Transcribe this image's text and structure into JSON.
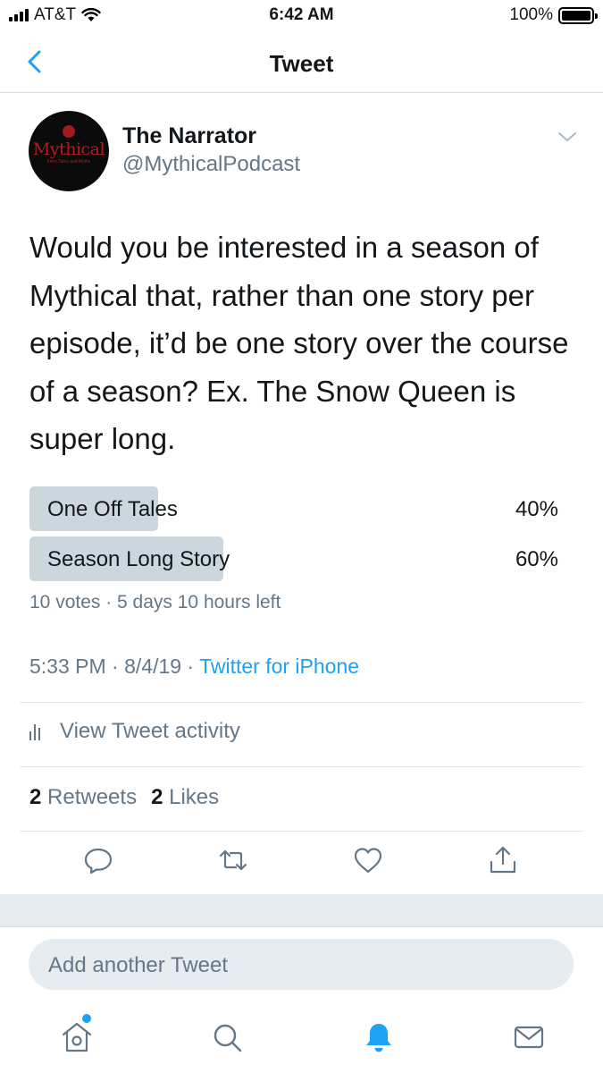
{
  "status_bar": {
    "carrier": "AT&T",
    "time": "6:42 AM",
    "battery": "100%"
  },
  "nav": {
    "title": "Tweet",
    "back_icon": "chevron-left-icon"
  },
  "tweet": {
    "display_name": "The Narrator",
    "handle": "@MythicalPodcast",
    "avatar_text": "Mythical",
    "avatar_subtext": "Fairy Tales and Myths",
    "text": "Would you be interested in a season of Mythical that, rather than one story per episode, it’d be one story over the course of a season? Ex. The Snow Queen is super long.",
    "poll": {
      "options": [
        {
          "label": "One Off Tales",
          "percent_text": "40%",
          "share": 0.4
        },
        {
          "label": "Season Long Story",
          "percent_text": "60%",
          "share": 0.6
        }
      ],
      "meta": "10 votes · 5 days 10 hours left"
    },
    "timestamp": "5:33 PM · 8/4/19 · ",
    "source": "Twitter for iPhone",
    "activity_label": "View Tweet activity",
    "retweets_count": "2",
    "retweets_label": "Retweets",
    "likes_count": "2",
    "likes_label": "Likes"
  },
  "actions": [
    "reply-icon",
    "retweet-icon",
    "like-icon",
    "share-icon"
  ],
  "reply": {
    "placeholder": "Add another Tweet"
  },
  "tabs": [
    "home-icon",
    "search-icon",
    "notifications-icon",
    "messages-icon"
  ],
  "colors": {
    "accent": "#1da1f2",
    "secondary_text": "#657786",
    "poll_bar": "#ccd6dd",
    "band": "#e6ecf0"
  }
}
